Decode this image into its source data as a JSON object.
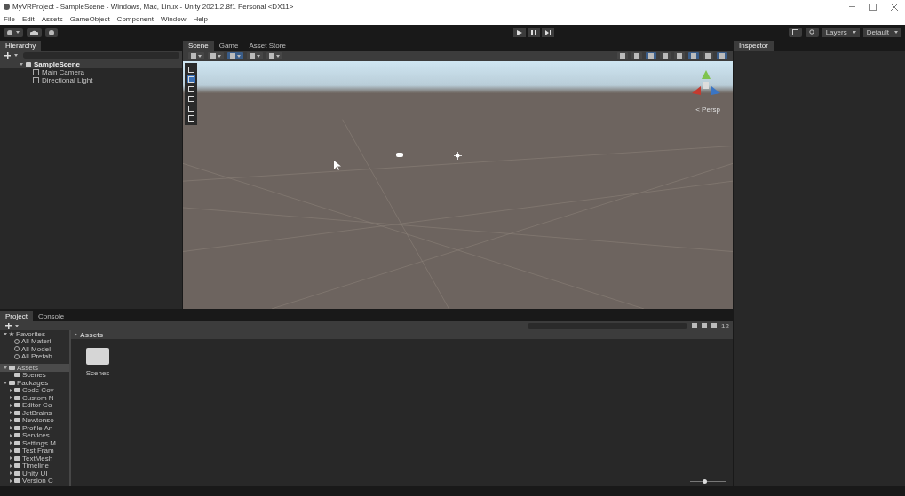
{
  "window": {
    "title": "MyVRProject - SampleScene - Windows, Mac, Linux - Unity 2021.2.8f1 Personal <DX11>"
  },
  "menu": [
    "File",
    "Edit",
    "Assets",
    "GameObject",
    "Component",
    "Window",
    "Help"
  ],
  "toolbar": {
    "layers": "Layers",
    "layout": "Default"
  },
  "hierarchy": {
    "title": "Hierarchy",
    "scene": {
      "label": "SampleScene",
      "expanded": true,
      "children": [
        {
          "label": "Main Camera"
        },
        {
          "label": "Directional Light"
        }
      ]
    }
  },
  "scene_tabs": [
    {
      "label": "Scene",
      "selected": true
    },
    {
      "label": "Game",
      "selected": false
    },
    {
      "label": "Asset Store",
      "selected": false
    }
  ],
  "scene_view": {
    "projection": "< Persp",
    "tools": [
      {
        "selected": false
      },
      {
        "selected": true
      },
      {
        "selected": false
      },
      {
        "selected": false
      },
      {
        "selected": false
      },
      {
        "selected": false
      }
    ]
  },
  "inspector": {
    "title": "Inspector"
  },
  "bottom_tabs": [
    {
      "label": "Project",
      "selected": true
    },
    {
      "label": "Console",
      "selected": false
    }
  ],
  "project": {
    "favorites": {
      "label": "Favorites",
      "items": [
        "All Materi",
        "All Model",
        "All Prefab"
      ]
    },
    "assets": {
      "label": "Assets",
      "selected": true,
      "children": [
        "Scenes"
      ]
    },
    "packages": {
      "label": "Packages",
      "children": [
        "Code Cov",
        "Custom N",
        "Editor Co",
        "JetBrains",
        "Newtonso",
        "Profile An",
        "Services",
        "Settings M",
        "Test Fram",
        "TextMesh",
        "Timeline",
        "Unity UI",
        "Version C"
      ]
    },
    "breadcrumb": "Assets",
    "files": [
      {
        "name": "Scenes"
      }
    ],
    "hidden_count": "12",
    "zoom": {
      "level": 0.4
    }
  }
}
